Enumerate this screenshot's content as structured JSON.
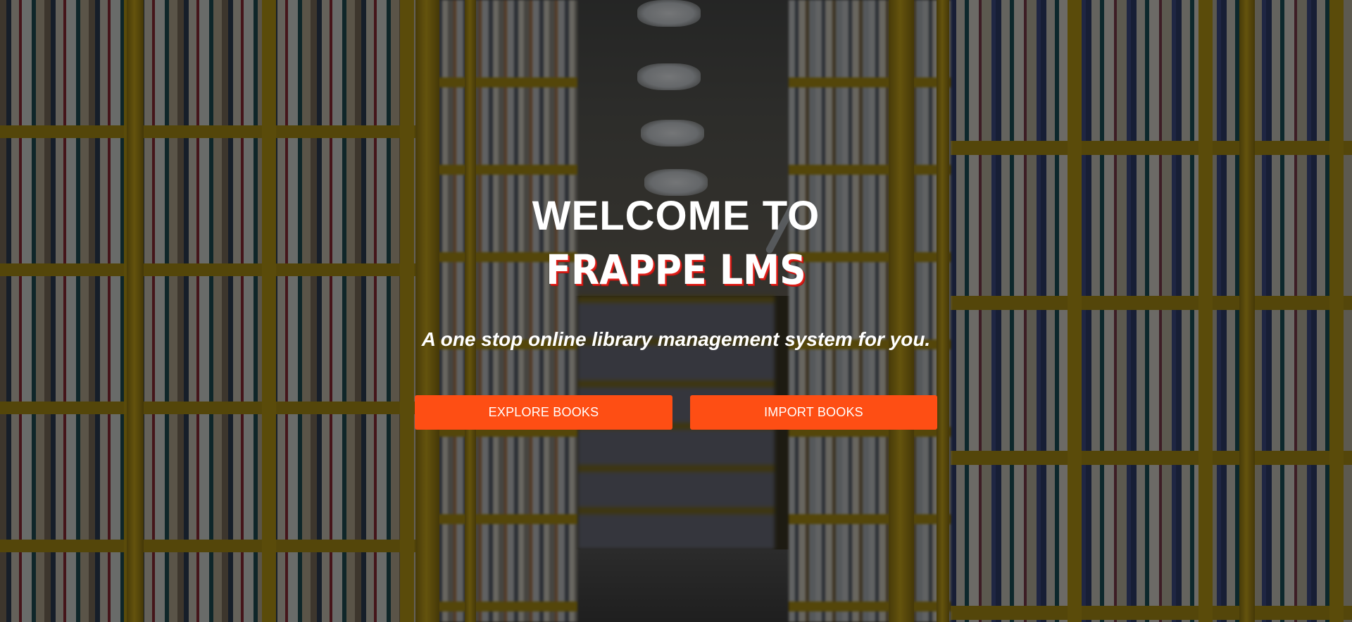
{
  "hero": {
    "heading_line1": "WELCOME TO",
    "heading_line2": "FRAPPE LMS",
    "tagline": "A one stop online library management system for you.",
    "buttons": {
      "explore_label": "EXPLORE BOOKS",
      "import_label": "IMPORT BOOKS"
    },
    "colors": {
      "button_background": "#fe4e14",
      "button_text": "#ffffff",
      "heading_text": "#ffffff",
      "brand_shadow": "#e0201a",
      "overlay": "rgba(0,0,0,0.5)"
    }
  }
}
